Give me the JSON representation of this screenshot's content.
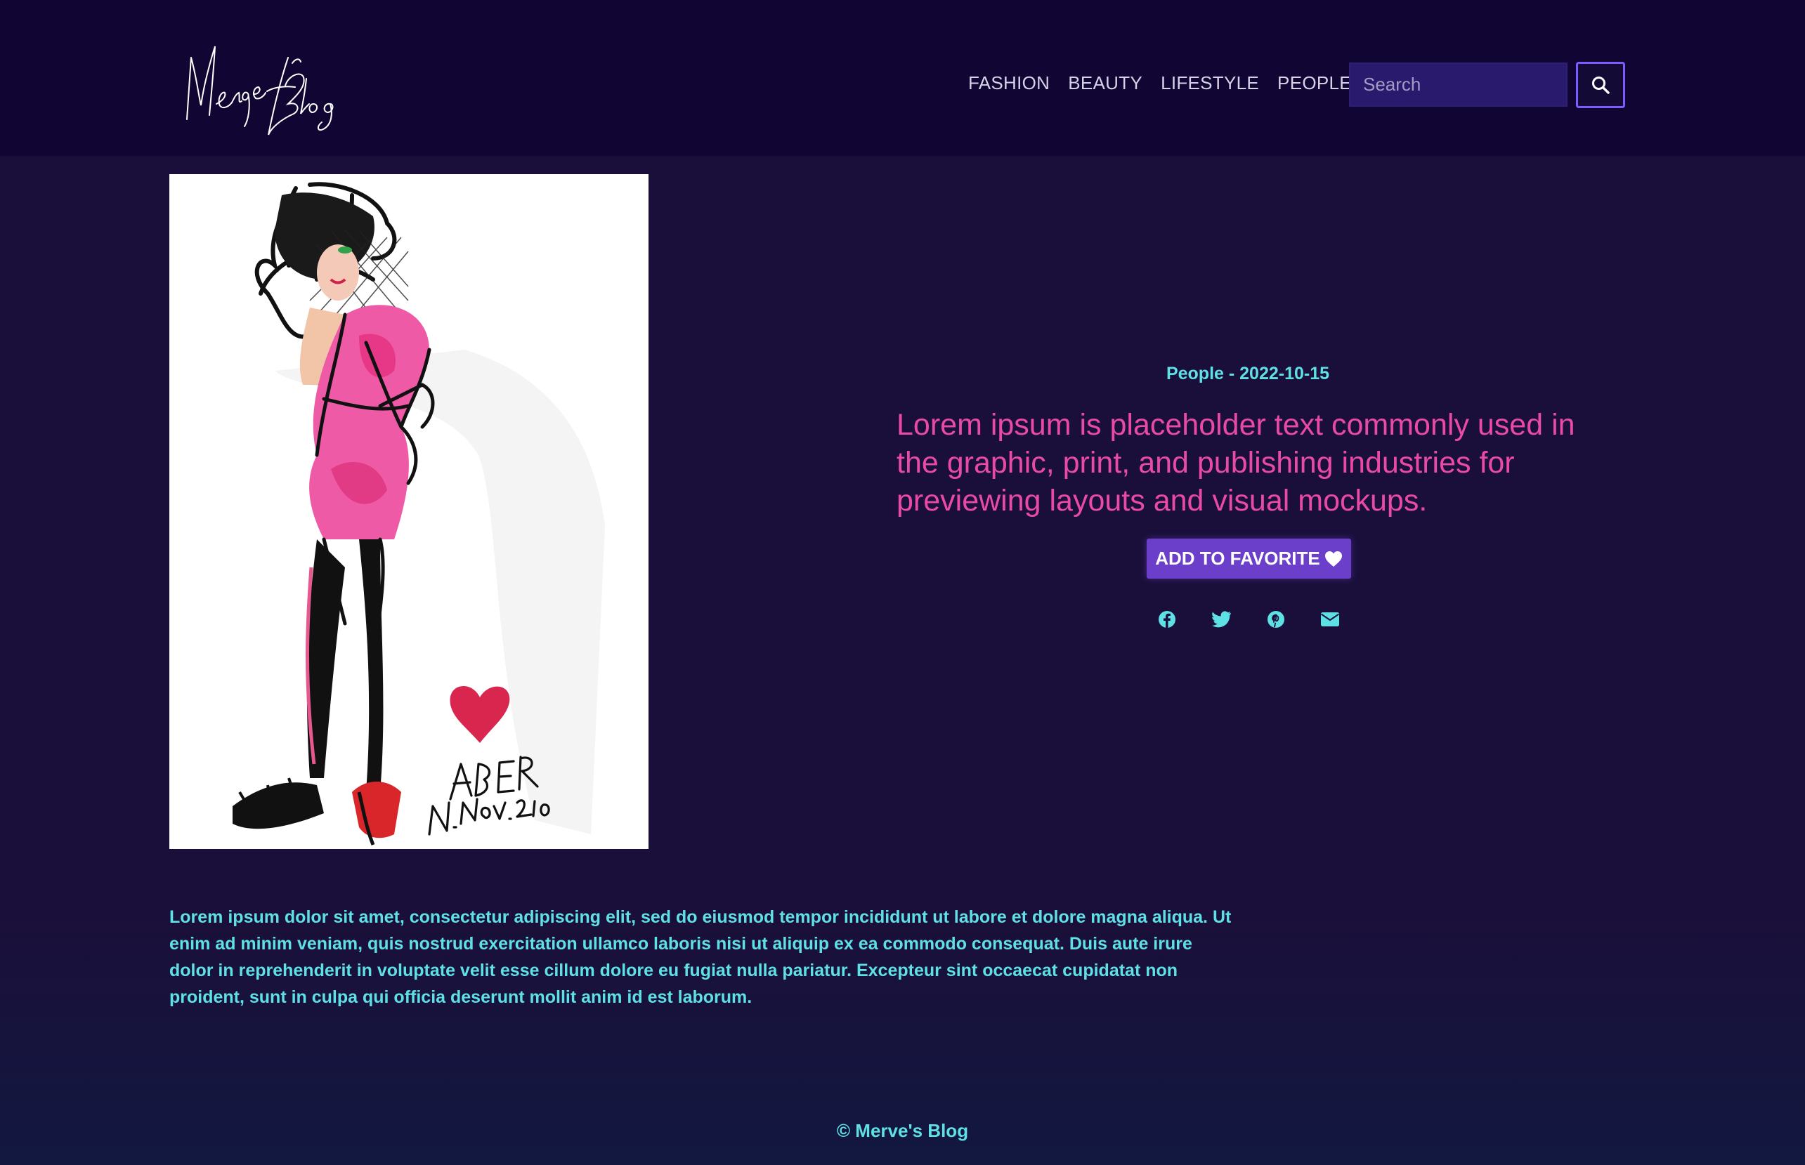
{
  "header": {
    "logo_text": "Merve's Blog"
  },
  "nav": {
    "items": [
      "FASHION",
      "BEAUTY",
      "LIFESTYLE",
      "PEOPLE"
    ]
  },
  "search": {
    "placeholder": "Search",
    "button_icon": "search-icon"
  },
  "article": {
    "category": "People",
    "date": "2022-10-15",
    "meta": "People - 2022-10-15",
    "title": "Lorem ipsum is placeholder text commonly used in the graphic, print, and publishing industries for previewing layouts and visual mockups.",
    "favorite_label": "ADD TO FAVORITE",
    "favorite_icon": "heart-icon",
    "share_icons": [
      "facebook-icon",
      "twitter-icon",
      "pinterest-icon",
      "email-icon"
    ],
    "body": "Lorem ipsum dolor sit amet, consectetur adipiscing elit, sed do eiusmod tempor incididunt ut labore et dolore magna aliqua. Ut enim ad minim veniam, quis nostrud exercitation ullamco laboris nisi ut aliquip ex ea commodo consequat. Duis aute irure dolor in reprehenderit in voluptate velit esse cillum dolore eu fugiat nulla pariatur. Excepteur sint occaecat cupidatat non proident, sunt in culpa qui officia deserunt mollit anim id est laborum.",
    "illustration_signature": [
      "ABER",
      "11.Nov.2010"
    ]
  },
  "footer": {
    "text": "© Merve's Blog"
  },
  "colors": {
    "background": "#1a0f3a",
    "header": "#110633",
    "accent_cyan": "#5ee0e4",
    "accent_pink": "#e94aa6",
    "button_purple": "#6b3fc9"
  }
}
